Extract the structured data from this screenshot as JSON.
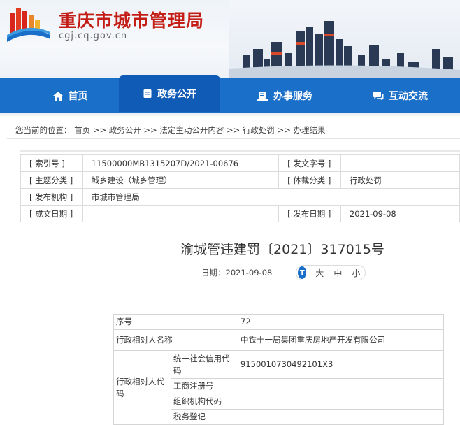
{
  "site": {
    "title": "重庆市城市管理局",
    "domain": "cgj.cq.gov.cn"
  },
  "nav": [
    {
      "label": "首页",
      "icon": "home-icon"
    },
    {
      "label": "政务公开",
      "icon": "document-icon",
      "active": true
    },
    {
      "label": "办事服务",
      "icon": "service-icon"
    },
    {
      "label": "互动交流",
      "icon": "chat-icon"
    }
  ],
  "breadcrumb": {
    "prefix": "您当前的位置：",
    "items": [
      "首页",
      "政务公开",
      "法定主动公开内容",
      "行政处罚",
      "办理结果"
    ],
    "separator": ">>"
  },
  "info": {
    "rows": [
      {
        "k1": "[ 索引号 ]",
        "v1": "11500000MB1315207D/2021-00676",
        "k2": "[ 发文字号 ]",
        "v2": ""
      },
      {
        "k1": "[ 主题分类 ]",
        "v1": "城乡建设（城乡管理）",
        "k2": "[ 体裁分类 ]",
        "v2": "行政处罚"
      },
      {
        "k1": "[ 发布机构 ]",
        "v1": "市城市管理局"
      },
      {
        "k1": "[ 成文日期 ]",
        "v1": "",
        "k2": "[ 发布日期 ]",
        "v2": "2021-09-08"
      }
    ]
  },
  "document": {
    "title": "渝城管违建罚〔2021〕317015号",
    "date_label": "日期：",
    "date": "2021-09-08",
    "font_sizes": [
      "大",
      "中",
      "小"
    ]
  },
  "table": {
    "seq_label": "序号",
    "seq_value": "72",
    "party_label": "行政相对人名称",
    "party_value": "中铁十一局集团重庆房地产开发有限公司",
    "code_label": "行政相对人代码",
    "code_rows": [
      {
        "label": "统一社会信用代码",
        "value": "9150010730492101X3"
      },
      {
        "label": "工商注册号",
        "value": ""
      },
      {
        "label": "组织机构代码",
        "value": ""
      },
      {
        "label": "税务登记",
        "value": ""
      }
    ]
  },
  "colors": {
    "nav_blue": "#1a6fc8",
    "title_red": "#c41d16"
  }
}
